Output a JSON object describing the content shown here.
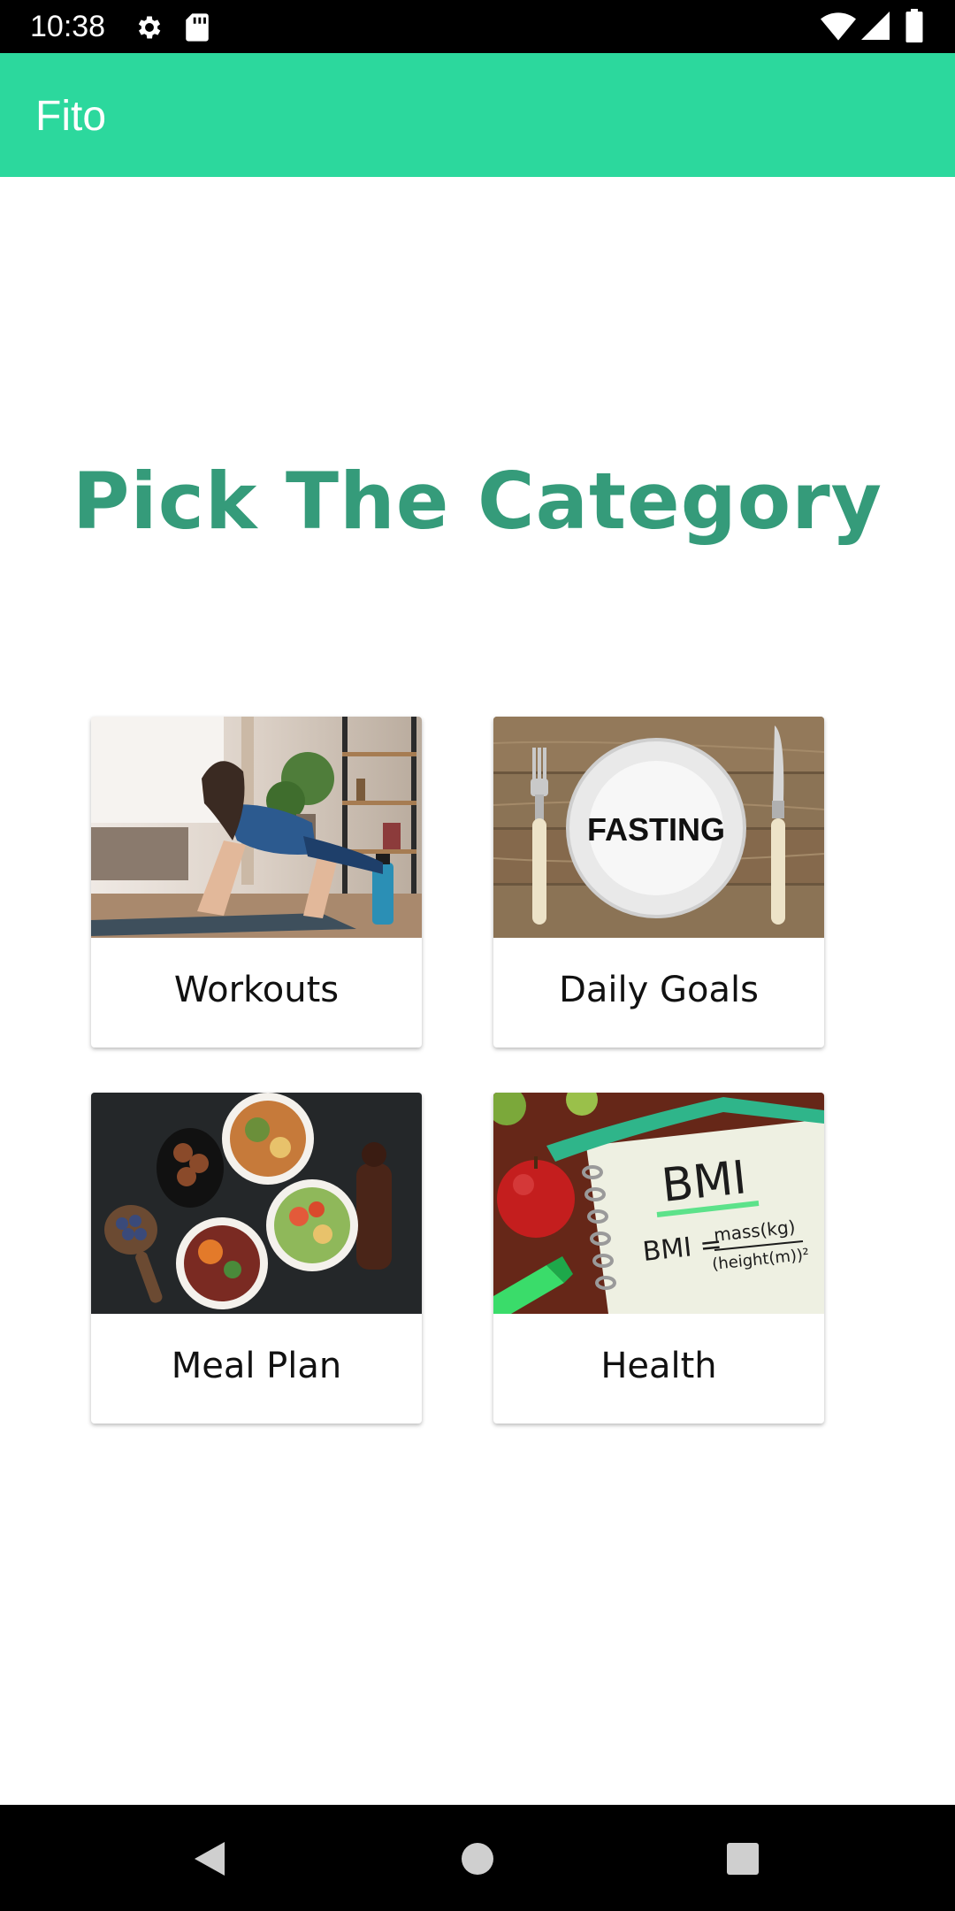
{
  "status_bar": {
    "time": "10:38",
    "icons": [
      "gear-icon",
      "sd-card-icon",
      "wifi-icon",
      "cell-signal-icon",
      "battery-icon"
    ]
  },
  "app_bar": {
    "title": "Fito",
    "color": "#2cd89d"
  },
  "heading": {
    "text": "Pick The Category",
    "color": "#359b7a"
  },
  "categories": [
    {
      "label": "Workouts",
      "image": "woman-doing-pushups"
    },
    {
      "label": "Daily Goals",
      "image": "fasting-plate",
      "image_text": "FASTING"
    },
    {
      "label": "Meal Plan",
      "image": "healthy-food-bowls"
    },
    {
      "label": "Health",
      "image": "bmi-notebook",
      "image_text": [
        "BMI",
        "BMI =",
        "mass(kg)",
        "(height(m))²"
      ]
    }
  ],
  "nav_bar": {
    "buttons": [
      "back-icon",
      "home-icon",
      "recents-icon"
    ]
  }
}
